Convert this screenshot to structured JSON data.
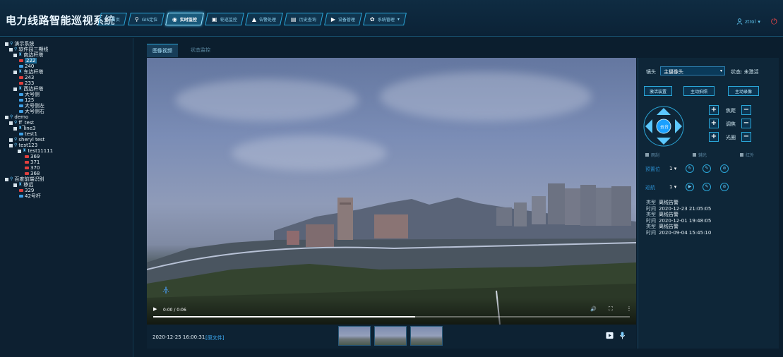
{
  "app": {
    "title": "电力线路智能巡视系统"
  },
  "nav": [
    {
      "label": "首页",
      "icon": "⌂"
    },
    {
      "label": "GIS定位",
      "icon": "⚲"
    },
    {
      "label": "实时监控",
      "icon": "◉"
    },
    {
      "label": "轮巡监控",
      "icon": "▣"
    },
    {
      "label": "告警处理",
      "icon": "▲"
    },
    {
      "label": "历史查询",
      "icon": "▤"
    },
    {
      "label": "设备管理",
      "icon": "▶"
    },
    {
      "label": "系统管理",
      "icon": "✿"
    }
  ],
  "user": {
    "name": "ztrol"
  },
  "tree": [
    {
      "label": "演示系统",
      "type": "group"
    },
    {
      "label": "软件园三期线",
      "type": "line"
    },
    {
      "label": "南边杆塔",
      "type": "tower"
    },
    {
      "label": "222",
      "type": "cam-off",
      "selected": true
    },
    {
      "label": "240",
      "type": "cam-on"
    },
    {
      "label": "东边杆塔",
      "type": "tower"
    },
    {
      "label": "243",
      "type": "cam-off"
    },
    {
      "label": "233",
      "type": "cam-off"
    },
    {
      "label": "西边杆塔",
      "type": "tower"
    },
    {
      "label": "大号侧",
      "type": "cam-on"
    },
    {
      "label": "125",
      "type": "cam-on"
    },
    {
      "label": "大号侧左",
      "type": "cam-on"
    },
    {
      "label": "大号侧右",
      "type": "cam-on"
    },
    {
      "label": "demo",
      "type": "group"
    },
    {
      "label": "ff_test",
      "type": "line"
    },
    {
      "label": "line3",
      "type": "tower"
    },
    {
      "label": "test1",
      "type": "cam-on"
    },
    {
      "label": "sheryl test",
      "type": "line"
    },
    {
      "label": "test123",
      "type": "line"
    },
    {
      "label": "test11111",
      "type": "tower"
    },
    {
      "label": "369",
      "type": "cam-off"
    },
    {
      "label": "371",
      "type": "cam-off"
    },
    {
      "label": "370",
      "type": "cam-off"
    },
    {
      "label": "368",
      "type": "cam-off"
    },
    {
      "label": "百度前端识别",
      "type": "group"
    },
    {
      "label": "移远",
      "type": "tower"
    },
    {
      "label": "329",
      "type": "cam-off"
    },
    {
      "label": "42号杆",
      "type": "cam-on"
    }
  ],
  "tabs": [
    {
      "label": "图像视频"
    },
    {
      "label": "状态监控"
    }
  ],
  "player": {
    "time": "0:00 / 0:06",
    "progress": 0.55
  },
  "clip": {
    "datetime": "2020-12-25 16:00:31",
    "orig_link": "[原文件]"
  },
  "panel": {
    "lens_label": "镜头",
    "lens_value": "主摄像头",
    "status": "状态: 未激活",
    "buttons": {
      "activate": "激活装置",
      "capture": "主动拍照",
      "record": "主动录像"
    },
    "ptz_center": "云台",
    "zoom": {
      "focus": "焦距",
      "adjust": "调焦",
      "iris": "光圈"
    },
    "toggles": {
      "wiper": "雨刮",
      "aux_light": "辅光",
      "infrared": "红外"
    },
    "preset": {
      "label": "预置位",
      "value": "1"
    },
    "cruise": {
      "label": "巡航",
      "value": "1"
    }
  },
  "alarms": [
    {
      "type_k": "类型",
      "type_v": "离线告警",
      "time_k": "时间",
      "time_v": "2020-12-23 21:05:05"
    },
    {
      "type_k": "类型",
      "type_v": "离线告警",
      "time_k": "时间",
      "time_v": "2020-12-01 19:48:05"
    },
    {
      "type_k": "类型",
      "type_v": "离线告警",
      "time_k": "时间",
      "time_v": "2020-09-04 15:45:10"
    }
  ]
}
